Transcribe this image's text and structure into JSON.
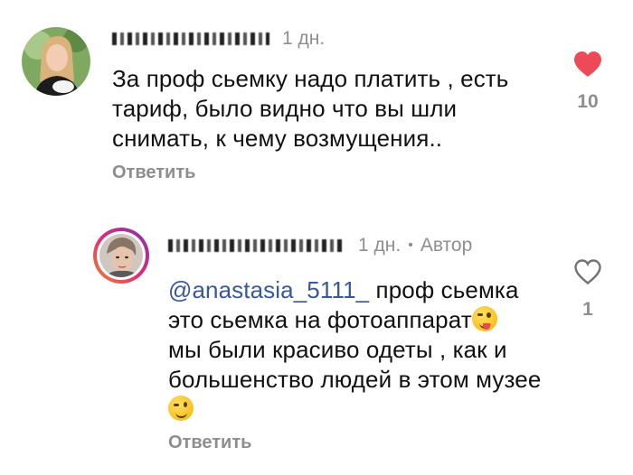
{
  "comments": [
    {
      "time": "1 дн.",
      "text": "За проф сьемку надо платить , есть тариф, было видно что вы шли снимать, к чему возмущения..",
      "reply_label": "Ответить",
      "like_count": "10",
      "liked": true
    }
  ],
  "reply": {
    "time": "1 дн.",
    "separator": "•",
    "author_badge": "Автор",
    "mention": "@anastasia_5111_",
    "text_part1": " проф сьемка это сьемка на фотоаппарат",
    "text_part2": "мы были красиво одеты , как и большенство  людей в этом музее ",
    "reply_label": "Ответить",
    "like_count": "1",
    "liked": false
  },
  "icons": {
    "heart_filled": "heart-filled-icon",
    "heart_outline": "heart-outline-icon",
    "emoji_tongue": "winking-face-with-tongue-icon",
    "emoji_wink": "winking-face-icon"
  },
  "colors": {
    "heart": "#ed4956",
    "mention": "#385898",
    "muted": "#8e8e8e",
    "story_ring_start": "#f58529",
    "story_ring_end": "#dd2a7b"
  }
}
